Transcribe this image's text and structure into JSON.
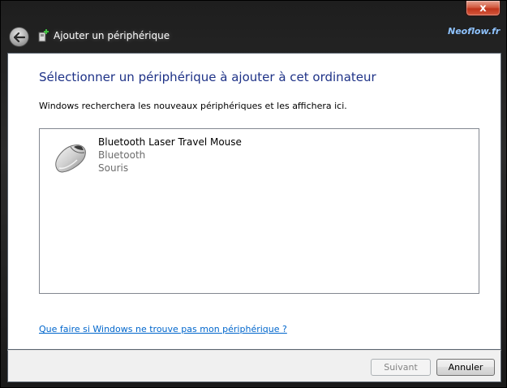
{
  "window": {
    "title": "Ajouter un périphérique",
    "brand": "Neoflow.fr",
    "close_glyph": "x"
  },
  "content": {
    "heading": "Sélectionner un périphérique à ajouter à cet ordinateur",
    "subtext": "Windows recherchera les nouveaux périphériques et les affichera ici.",
    "devices": [
      {
        "name": "Bluetooth Laser Travel Mouse",
        "type": "Bluetooth",
        "category": "Souris",
        "icon": "mouse-icon"
      }
    ],
    "help_link": "Que faire si Windows ne trouve pas mon périphérique ?"
  },
  "footer": {
    "next_label": "Suivant",
    "next_enabled": false,
    "cancel_label": "Annuler"
  },
  "colors": {
    "heading": "#1e3287",
    "link": "#0066cc",
    "close": "#c0341b",
    "brand": "#8fc3ff"
  }
}
